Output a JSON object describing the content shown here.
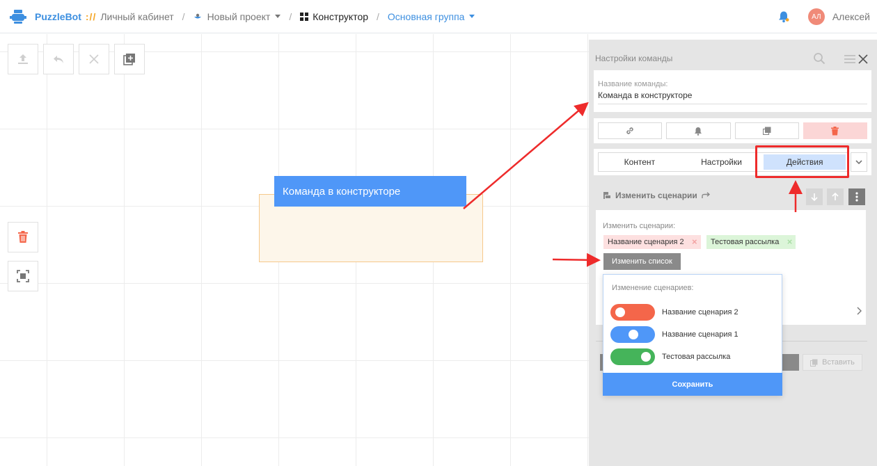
{
  "header": {
    "brand": "PuzzleBot",
    "brand_sep": "://",
    "breadcrumbs": [
      {
        "label": "Личный кабинет"
      },
      {
        "label": "Новый проект"
      },
      {
        "label": "Конструктор"
      },
      {
        "label": "Основная группа"
      }
    ],
    "user": {
      "initials": "АЛ",
      "name": "Алексей"
    }
  },
  "canvas": {
    "node_label": "Команда в конструкторе"
  },
  "panel": {
    "title": "Настройки команды",
    "name_label": "Название команды:",
    "name_value": "Команда в конструкторе",
    "tabs": [
      "Контент",
      "Настройки",
      "Действия"
    ],
    "active_tab": "Действия",
    "action": {
      "header": "Изменить сценарии",
      "field_label": "Изменить сценарии:",
      "tags": [
        {
          "label": "Название сценария 2",
          "color": "#fde0e0"
        },
        {
          "label": "Тестовая рассылка",
          "color": "#dcf5d9"
        }
      ],
      "change_button": "Изменить список"
    },
    "paste_button": "Вставить"
  },
  "popup": {
    "title": "Изменение сценариев:",
    "toggles": [
      {
        "label": "Название сценария 2",
        "color": "#f4664a",
        "state": "off"
      },
      {
        "label": "Название сценария 1",
        "color": "#4f97f8",
        "state": "middle"
      },
      {
        "label": "Тестовая рассылка",
        "color": "#45b45a",
        "state": "on"
      }
    ],
    "save_button": "Сохранить"
  },
  "colors": {
    "accent_blue": "#4f97f8",
    "annotation_red": "#ee2b2b",
    "brand_blue": "#3d8fe0",
    "brand_orange": "#f5a524"
  }
}
